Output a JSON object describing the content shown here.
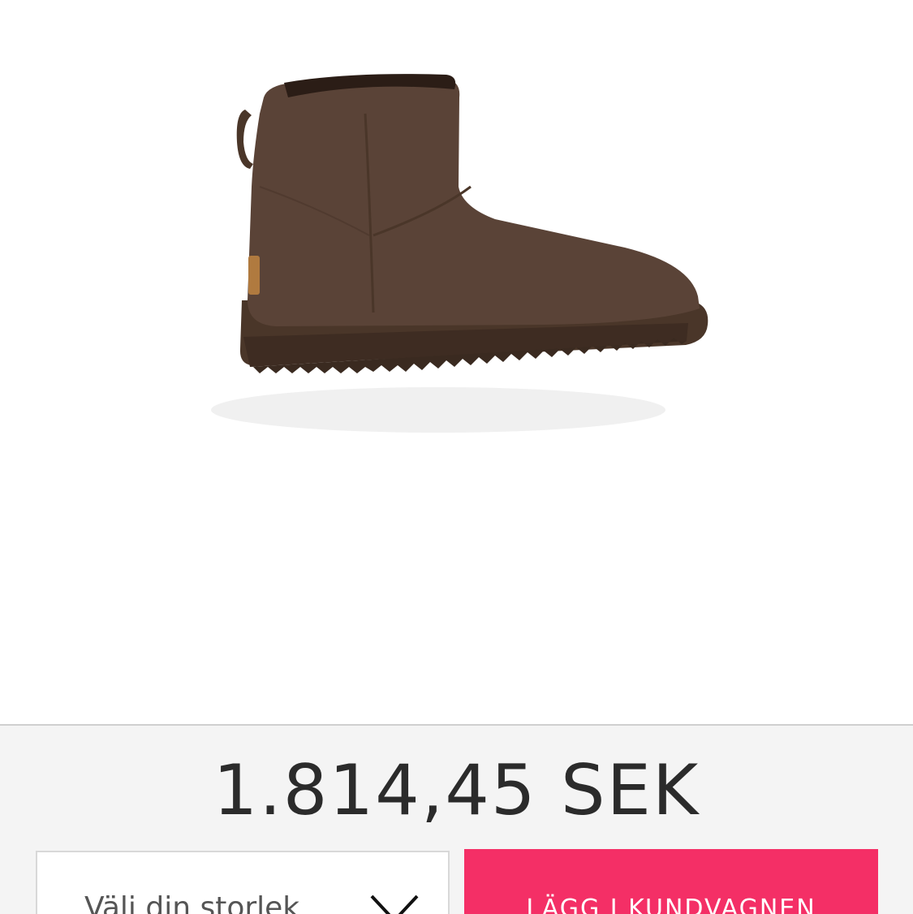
{
  "product": {
    "image_icon": "ugg-mini-boot-image",
    "boot_color": "#5a4337"
  },
  "purchase": {
    "price": "1.814,45 SEK",
    "size_select": {
      "placeholder": "Välj din storlek",
      "icon": "chevron-down-icon"
    },
    "add_to_cart_label": "LÄGG I KUNDVAGNEN",
    "accent_color": "#f42f66"
  }
}
